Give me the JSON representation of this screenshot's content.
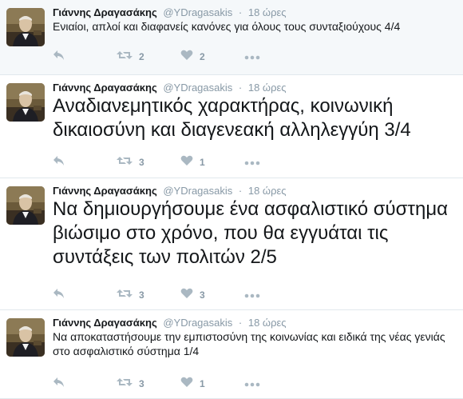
{
  "tweets": [
    {
      "name": "Γιάννης Δραγασάκης",
      "handle": "@YDragasakis",
      "separator": "·",
      "time": "18 ώρες",
      "text": "Ενιαίοι, απλοί και διαφανείς κανόνες για όλους τους συνταξιούχους 4/4",
      "retweets": "2",
      "likes": "2"
    },
    {
      "name": "Γιάννης Δραγασάκης",
      "handle": "@YDragasakis",
      "separator": "·",
      "time": "18 ώρες",
      "text": "Αναδιανεμητικός χαρακτήρας, κοινωνική δικαιοσύνη και διαγενεακή αλληλεγγύη 3/4",
      "retweets": "3",
      "likes": "1"
    },
    {
      "name": "Γιάννης Δραγασάκης",
      "handle": "@YDragasakis",
      "separator": "·",
      "time": "18 ώρες",
      "text": "Να δημιουργήσουμε ένα ασφαλιστικό σύστημα βιώσιμο στο χρόνο, που θα εγγυάται τις συντάξεις των πολιτών 2/5",
      "retweets": "3",
      "likes": "3"
    },
    {
      "name": "Γιάννης Δραγασάκης",
      "handle": "@YDragasakis",
      "separator": "·",
      "time": "18 ώρες",
      "text": "Να αποκαταστήσουμε την εμπιστοσύνη της κοινωνίας και ειδικά της νέας γενιάς στο ασφαλιστικό σύστημα 1/4",
      "retweets": "3",
      "likes": "1"
    }
  ],
  "icons": {
    "reply": "reply-icon",
    "retweet": "retweet-icon",
    "like": "heart-icon",
    "more": "more-icon"
  },
  "colors": {
    "action_gray": "#aab8c2",
    "meta_gray": "#8899a6",
    "highlight_bg": "#f5f8fa"
  }
}
